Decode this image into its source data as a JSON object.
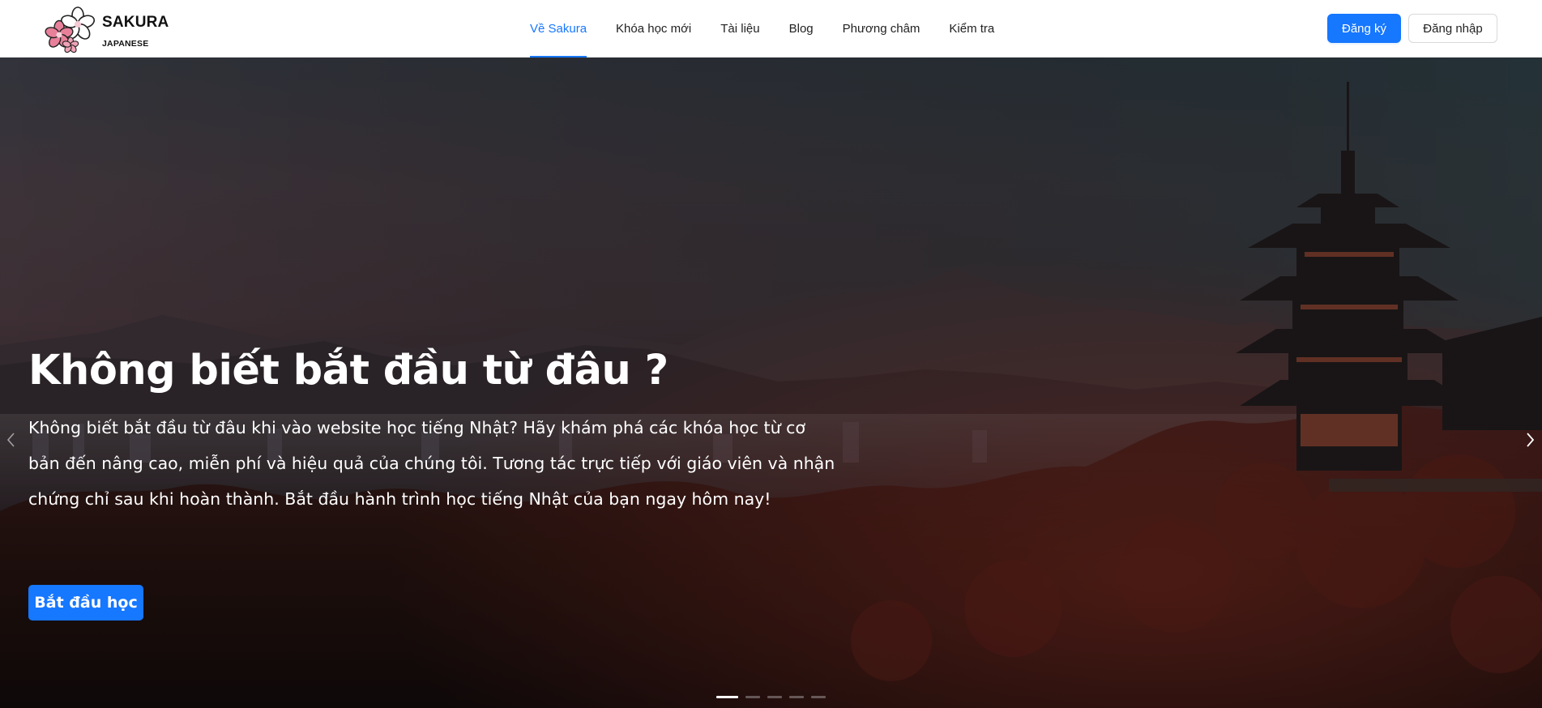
{
  "logo": {
    "title": "SAKURA",
    "subtitle": "JAPANESE",
    "flower_color": "#e8809a"
  },
  "nav": {
    "items": [
      {
        "label": "Về Sakura",
        "active": true
      },
      {
        "label": "Khóa học mới",
        "active": false
      },
      {
        "label": "Tài liệu",
        "active": false
      },
      {
        "label": "Blog",
        "active": false
      },
      {
        "label": "Phương châm",
        "active": false
      },
      {
        "label": "Kiểm tra",
        "active": false
      }
    ]
  },
  "auth": {
    "register_label": "Đăng ký",
    "login_label": "Đăng nhập"
  },
  "hero": {
    "title": "Không biết bắt đầu từ đâu ?",
    "description": "Không biết bắt đầu từ đâu khi vào website học tiếng Nhật? Hãy khám phá các khóa học từ cơ bản đến nâng cao, miễn phí và hiệu quả của chúng tôi. Tương tác trực tiếp với giáo viên và nhận chứng chỉ sau khi hoàn thành. Bắt đầu hành trình học tiếng Nhật của bạn ngay hôm nay!",
    "cta_label": "Bắt đầu học",
    "prev_icon": "chevron-left-icon",
    "next_icon": "chevron-right-icon"
  },
  "carousel": {
    "slide_count": 5,
    "active_slide": 1
  },
  "colors": {
    "accent": "#1677ff",
    "nav_text": "#222222"
  }
}
